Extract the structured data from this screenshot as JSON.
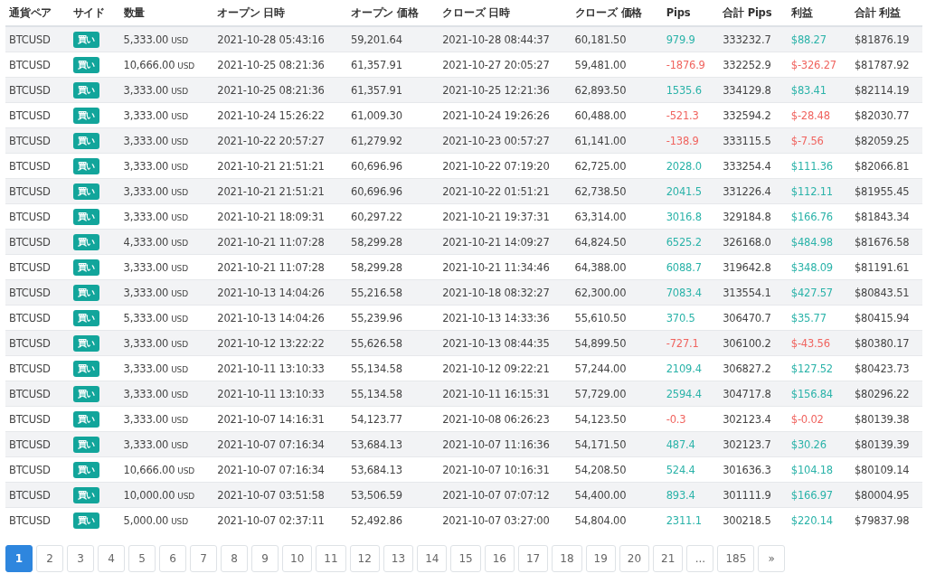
{
  "table": {
    "columns": [
      "通貨ペア",
      "サイド",
      "数量",
      "オープン 日時",
      "オープン 価格",
      "クローズ 日時",
      "クローズ 価格",
      "Pips",
      "合計 Pips",
      "利益",
      "合計 利益"
    ],
    "rows": [
      {
        "pair": "BTCUSD",
        "side": "買い",
        "qty": "5,333.00",
        "unit": "USD",
        "open_time": "2021-10-28 05:43:16",
        "open_price": "59,201.64",
        "close_time": "2021-10-28 08:44:37",
        "close_price": "60,181.50",
        "pips": "979.9",
        "total_pips": "333232.7",
        "profit": "$88.27",
        "total_profit": "$81876.19",
        "loss": false
      },
      {
        "pair": "BTCUSD",
        "side": "買い",
        "qty": "10,666.00",
        "unit": "USD",
        "open_time": "2021-10-25 08:21:36",
        "open_price": "61,357.91",
        "close_time": "2021-10-27 20:05:27",
        "close_price": "59,481.00",
        "pips": "-1876.9",
        "total_pips": "332252.9",
        "profit": "$-326.27",
        "total_profit": "$81787.92",
        "loss": true
      },
      {
        "pair": "BTCUSD",
        "side": "買い",
        "qty": "3,333.00",
        "unit": "USD",
        "open_time": "2021-10-25 08:21:36",
        "open_price": "61,357.91",
        "close_time": "2021-10-25 12:21:36",
        "close_price": "62,893.50",
        "pips": "1535.6",
        "total_pips": "334129.8",
        "profit": "$83.41",
        "total_profit": "$82114.19",
        "loss": false
      },
      {
        "pair": "BTCUSD",
        "side": "買い",
        "qty": "3,333.00",
        "unit": "USD",
        "open_time": "2021-10-24 15:26:22",
        "open_price": "61,009.30",
        "close_time": "2021-10-24 19:26:26",
        "close_price": "60,488.00",
        "pips": "-521.3",
        "total_pips": "332594.2",
        "profit": "$-28.48",
        "total_profit": "$82030.77",
        "loss": true
      },
      {
        "pair": "BTCUSD",
        "side": "買い",
        "qty": "3,333.00",
        "unit": "USD",
        "open_time": "2021-10-22 20:57:27",
        "open_price": "61,279.92",
        "close_time": "2021-10-23 00:57:27",
        "close_price": "61,141.00",
        "pips": "-138.9",
        "total_pips": "333115.5",
        "profit": "$-7.56",
        "total_profit": "$82059.25",
        "loss": true
      },
      {
        "pair": "BTCUSD",
        "side": "買い",
        "qty": "3,333.00",
        "unit": "USD",
        "open_time": "2021-10-21 21:51:21",
        "open_price": "60,696.96",
        "close_time": "2021-10-22 07:19:20",
        "close_price": "62,725.00",
        "pips": "2028.0",
        "total_pips": "333254.4",
        "profit": "$111.36",
        "total_profit": "$82066.81",
        "loss": false
      },
      {
        "pair": "BTCUSD",
        "side": "買い",
        "qty": "3,333.00",
        "unit": "USD",
        "open_time": "2021-10-21 21:51:21",
        "open_price": "60,696.96",
        "close_time": "2021-10-22 01:51:21",
        "close_price": "62,738.50",
        "pips": "2041.5",
        "total_pips": "331226.4",
        "profit": "$112.11",
        "total_profit": "$81955.45",
        "loss": false
      },
      {
        "pair": "BTCUSD",
        "side": "買い",
        "qty": "3,333.00",
        "unit": "USD",
        "open_time": "2021-10-21 18:09:31",
        "open_price": "60,297.22",
        "close_time": "2021-10-21 19:37:31",
        "close_price": "63,314.00",
        "pips": "3016.8",
        "total_pips": "329184.8",
        "profit": "$166.76",
        "total_profit": "$81843.34",
        "loss": false
      },
      {
        "pair": "BTCUSD",
        "side": "買い",
        "qty": "4,333.00",
        "unit": "USD",
        "open_time": "2021-10-21 11:07:28",
        "open_price": "58,299.28",
        "close_time": "2021-10-21 14:09:27",
        "close_price": "64,824.50",
        "pips": "6525.2",
        "total_pips": "326168.0",
        "profit": "$484.98",
        "total_profit": "$81676.58",
        "loss": false
      },
      {
        "pair": "BTCUSD",
        "side": "買い",
        "qty": "3,333.00",
        "unit": "USD",
        "open_time": "2021-10-21 11:07:28",
        "open_price": "58,299.28",
        "close_time": "2021-10-21 11:34:46",
        "close_price": "64,388.00",
        "pips": "6088.7",
        "total_pips": "319642.8",
        "profit": "$348.09",
        "total_profit": "$81191.61",
        "loss": false
      },
      {
        "pair": "BTCUSD",
        "side": "買い",
        "qty": "3,333.00",
        "unit": "USD",
        "open_time": "2021-10-13 14:04:26",
        "open_price": "55,216.58",
        "close_time": "2021-10-18 08:32:27",
        "close_price": "62,300.00",
        "pips": "7083.4",
        "total_pips": "313554.1",
        "profit": "$427.57",
        "total_profit": "$80843.51",
        "loss": false
      },
      {
        "pair": "BTCUSD",
        "side": "買い",
        "qty": "5,333.00",
        "unit": "USD",
        "open_time": "2021-10-13 14:04:26",
        "open_price": "55,239.96",
        "close_time": "2021-10-13 14:33:36",
        "close_price": "55,610.50",
        "pips": "370.5",
        "total_pips": "306470.7",
        "profit": "$35.77",
        "total_profit": "$80415.94",
        "loss": false
      },
      {
        "pair": "BTCUSD",
        "side": "買い",
        "qty": "3,333.00",
        "unit": "USD",
        "open_time": "2021-10-12 13:22:22",
        "open_price": "55,626.58",
        "close_time": "2021-10-13 08:44:35",
        "close_price": "54,899.50",
        "pips": "-727.1",
        "total_pips": "306100.2",
        "profit": "$-43.56",
        "total_profit": "$80380.17",
        "loss": true
      },
      {
        "pair": "BTCUSD",
        "side": "買い",
        "qty": "3,333.00",
        "unit": "USD",
        "open_time": "2021-10-11 13:10:33",
        "open_price": "55,134.58",
        "close_time": "2021-10-12 09:22:21",
        "close_price": "57,244.00",
        "pips": "2109.4",
        "total_pips": "306827.2",
        "profit": "$127.52",
        "total_profit": "$80423.73",
        "loss": false
      },
      {
        "pair": "BTCUSD",
        "side": "買い",
        "qty": "3,333.00",
        "unit": "USD",
        "open_time": "2021-10-11 13:10:33",
        "open_price": "55,134.58",
        "close_time": "2021-10-11 16:15:31",
        "close_price": "57,729.00",
        "pips": "2594.4",
        "total_pips": "304717.8",
        "profit": "$156.84",
        "total_profit": "$80296.22",
        "loss": false
      },
      {
        "pair": "BTCUSD",
        "side": "買い",
        "qty": "3,333.00",
        "unit": "USD",
        "open_time": "2021-10-07 14:16:31",
        "open_price": "54,123.77",
        "close_time": "2021-10-08 06:26:23",
        "close_price": "54,123.50",
        "pips": "-0.3",
        "total_pips": "302123.4",
        "profit": "$-0.02",
        "total_profit": "$80139.38",
        "loss": true
      },
      {
        "pair": "BTCUSD",
        "side": "買い",
        "qty": "3,333.00",
        "unit": "USD",
        "open_time": "2021-10-07 07:16:34",
        "open_price": "53,684.13",
        "close_time": "2021-10-07 11:16:36",
        "close_price": "54,171.50",
        "pips": "487.4",
        "total_pips": "302123.7",
        "profit": "$30.26",
        "total_profit": "$80139.39",
        "loss": false
      },
      {
        "pair": "BTCUSD",
        "side": "買い",
        "qty": "10,666.00",
        "unit": "USD",
        "open_time": "2021-10-07 07:16:34",
        "open_price": "53,684.13",
        "close_time": "2021-10-07 10:16:31",
        "close_price": "54,208.50",
        "pips": "524.4",
        "total_pips": "301636.3",
        "profit": "$104.18",
        "total_profit": "$80109.14",
        "loss": false
      },
      {
        "pair": "BTCUSD",
        "side": "買い",
        "qty": "10,000.00",
        "unit": "USD",
        "open_time": "2021-10-07 03:51:58",
        "open_price": "53,506.59",
        "close_time": "2021-10-07 07:07:12",
        "close_price": "54,400.00",
        "pips": "893.4",
        "total_pips": "301111.9",
        "profit": "$166.97",
        "total_profit": "$80004.95",
        "loss": false
      },
      {
        "pair": "BTCUSD",
        "side": "買い",
        "qty": "5,000.00",
        "unit": "USD",
        "open_time": "2021-10-07 02:37:11",
        "open_price": "52,492.86",
        "close_time": "2021-10-07 03:27:00",
        "close_price": "54,804.00",
        "pips": "2311.1",
        "total_pips": "300218.5",
        "profit": "$220.14",
        "total_profit": "$79837.98",
        "loss": false
      }
    ]
  },
  "pagination": [
    {
      "label": "1",
      "selected": true
    },
    {
      "label": "2",
      "selected": false
    },
    {
      "label": "3",
      "selected": false
    },
    {
      "label": "4",
      "selected": false
    },
    {
      "label": "5",
      "selected": false
    },
    {
      "label": "6",
      "selected": false
    },
    {
      "label": "7",
      "selected": false
    },
    {
      "label": "8",
      "selected": false
    },
    {
      "label": "9",
      "selected": false
    },
    {
      "label": "10",
      "selected": false
    },
    {
      "label": "11",
      "selected": false
    },
    {
      "label": "12",
      "selected": false
    },
    {
      "label": "13",
      "selected": false
    },
    {
      "label": "14",
      "selected": false
    },
    {
      "label": "15",
      "selected": false
    },
    {
      "label": "16",
      "selected": false
    },
    {
      "label": "17",
      "selected": false
    },
    {
      "label": "18",
      "selected": false
    },
    {
      "label": "19",
      "selected": false
    },
    {
      "label": "20",
      "selected": false
    },
    {
      "label": "21",
      "selected": false
    },
    {
      "label": "...",
      "selected": false
    },
    {
      "label": "185",
      "selected": false
    },
    {
      "label": "»",
      "selected": false
    }
  ]
}
